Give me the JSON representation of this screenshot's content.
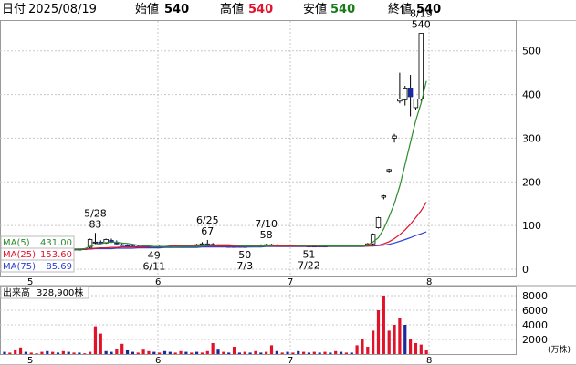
{
  "header": {
    "date_label": "日付",
    "date": "2025/08/19",
    "open_label": "始値",
    "open": "540",
    "high_label": "高値",
    "high": "540",
    "low_label": "安値",
    "low": "540",
    "close_label": "終値",
    "close": "540"
  },
  "ma_legend": [
    {
      "label": "MA(5)",
      "value": "431.00",
      "color": "#2e8b2e"
    },
    {
      "label": "MA(25)",
      "value": "153.60",
      "color": "#e0132b"
    },
    {
      "label": "MA(75)",
      "value": "85.69",
      "color": "#2c3fd1"
    }
  ],
  "volume_label": "出来高",
  "volume_value": "328,900株",
  "volume_unit": "(万株)",
  "colors": {
    "up": "#e0132b",
    "down": "#1a2a9c",
    "grid": "#c8c8c8",
    "ma5": "#2e8b2e",
    "ma25": "#e0132b",
    "ma75": "#2c3fd1"
  },
  "chart_data": {
    "type": "candlestick",
    "price_axis": {
      "ticks": [
        0,
        100,
        200,
        300,
        400,
        500
      ],
      "range": [
        0,
        560
      ]
    },
    "volume_axis": {
      "ticks": [
        2000,
        4000,
        6000,
        8000
      ],
      "range": [
        0,
        9000
      ]
    },
    "month_labels": [
      {
        "label": "5",
        "index": 0
      },
      {
        "label": "6",
        "index": 22
      },
      {
        "label": "7",
        "index": 43
      },
      {
        "label": "8",
        "index": 65
      }
    ],
    "annotations": [
      {
        "index": 17,
        "date": "5/28",
        "value": "83",
        "position": "above"
      },
      {
        "index": 28,
        "date": "6/11",
        "value": "49",
        "position": "below"
      },
      {
        "index": 38,
        "date": "6/25",
        "value": "67",
        "position": "above"
      },
      {
        "index": 45,
        "date": "7/3",
        "value": "50",
        "position": "below"
      },
      {
        "index": 49,
        "date": "7/10",
        "value": "58",
        "position": "above"
      },
      {
        "index": 57,
        "date": "7/22",
        "value": "51",
        "position": "below"
      },
      {
        "index": 78,
        "date": "8/19",
        "value": "540",
        "position": "above"
      }
    ],
    "candles": [
      [
        46,
        47,
        45,
        46
      ],
      [
        46,
        47,
        45,
        46
      ],
      [
        46,
        47,
        45,
        46
      ],
      [
        46,
        47,
        45,
        46
      ],
      [
        46,
        47,
        45,
        46
      ],
      [
        46,
        47,
        45,
        46
      ],
      [
        46,
        47,
        45,
        46
      ],
      [
        46,
        47,
        45,
        46
      ],
      [
        46,
        47,
        45,
        46
      ],
      [
        46,
        47,
        45,
        46
      ],
      [
        46,
        47,
        45,
        46
      ],
      [
        46,
        47,
        45,
        46
      ],
      [
        46,
        47,
        45,
        46
      ],
      [
        46,
        47,
        45,
        46
      ],
      [
        46,
        47,
        45,
        46
      ],
      [
        47,
        48,
        46,
        47
      ],
      [
        50,
        70,
        48,
        68
      ],
      [
        60,
        83,
        58,
        62
      ],
      [
        62,
        66,
        58,
        59
      ],
      [
        60,
        70,
        58,
        68
      ],
      [
        66,
        70,
        60,
        62
      ],
      [
        60,
        66,
        56,
        58
      ],
      [
        56,
        60,
        54,
        55
      ],
      [
        55,
        57,
        52,
        53
      ],
      [
        53,
        55,
        51,
        52
      ],
      [
        52,
        54,
        50,
        52
      ],
      [
        52,
        54,
        50,
        51
      ],
      [
        51,
        53,
        49,
        50
      ],
      [
        50,
        53,
        49,
        52
      ],
      [
        52,
        54,
        50,
        51
      ],
      [
        51,
        53,
        50,
        52
      ],
      [
        52,
        54,
        50,
        51
      ],
      [
        51,
        53,
        50,
        52
      ],
      [
        52,
        54,
        50,
        51
      ],
      [
        51,
        54,
        50,
        53
      ],
      [
        53,
        56,
        51,
        52
      ],
      [
        52,
        58,
        51,
        56
      ],
      [
        56,
        62,
        54,
        58
      ],
      [
        58,
        67,
        55,
        57
      ],
      [
        57,
        60,
        54,
        55
      ],
      [
        55,
        57,
        52,
        53
      ],
      [
        53,
        55,
        51,
        52
      ],
      [
        52,
        54,
        50,
        51
      ],
      [
        51,
        53,
        50,
        52
      ],
      [
        52,
        54,
        50,
        51
      ],
      [
        51,
        53,
        50,
        52
      ],
      [
        52,
        55,
        50,
        53
      ],
      [
        53,
        56,
        51,
        54
      ],
      [
        54,
        57,
        52,
        55
      ],
      [
        55,
        58,
        53,
        56
      ],
      [
        56,
        58,
        54,
        55
      ],
      [
        55,
        57,
        53,
        54
      ],
      [
        54,
        56,
        52,
        53
      ],
      [
        53,
        55,
        52,
        54
      ],
      [
        54,
        56,
        52,
        53
      ],
      [
        53,
        55,
        52,
        54
      ],
      [
        54,
        56,
        52,
        53
      ],
      [
        53,
        55,
        51,
        52
      ],
      [
        52,
        54,
        51,
        53
      ],
      [
        53,
        55,
        51,
        52
      ],
      [
        52,
        54,
        51,
        53
      ],
      [
        53,
        55,
        52,
        54
      ],
      [
        54,
        56,
        52,
        53
      ],
      [
        53,
        55,
        52,
        54
      ],
      [
        54,
        56,
        52,
        53
      ],
      [
        53,
        55,
        52,
        54
      ],
      [
        54,
        56,
        52,
        53
      ],
      [
        53,
        55,
        52,
        54
      ],
      [
        54,
        60,
        52,
        58
      ],
      [
        58,
        82,
        56,
        80
      ],
      [
        95,
        120,
        93,
        118
      ],
      [
        165,
        170,
        160,
        168
      ],
      [
        225,
        230,
        220,
        228
      ],
      [
        300,
        310,
        290,
        305
      ],
      [
        385,
        450,
        380,
        390
      ],
      [
        388,
        420,
        375,
        415
      ],
      [
        415,
        445,
        350,
        395
      ],
      [
        370,
        390,
        365,
        390
      ],
      [
        390,
        540,
        385,
        540
      ]
    ],
    "volume": [
      [
        300,
        "down"
      ],
      [
        200,
        "up"
      ],
      [
        500,
        "up"
      ],
      [
        900,
        "up"
      ],
      [
        300,
        "down"
      ],
      [
        200,
        "up"
      ],
      [
        100,
        "up"
      ],
      [
        300,
        "up"
      ],
      [
        400,
        "down"
      ],
      [
        300,
        "up"
      ],
      [
        200,
        "down"
      ],
      [
        400,
        "up"
      ],
      [
        300,
        "down"
      ],
      [
        200,
        "up"
      ],
      [
        200,
        "down"
      ],
      [
        100,
        "up"
      ],
      [
        300,
        "up"
      ],
      [
        3800,
        "up"
      ],
      [
        2800,
        "up"
      ],
      [
        400,
        "down"
      ],
      [
        300,
        "down"
      ],
      [
        700,
        "up"
      ],
      [
        1400,
        "up"
      ],
      [
        500,
        "down"
      ],
      [
        300,
        "down"
      ],
      [
        200,
        "up"
      ],
      [
        600,
        "up"
      ],
      [
        400,
        "up"
      ],
      [
        300,
        "down"
      ],
      [
        200,
        "up"
      ],
      [
        400,
        "down"
      ],
      [
        300,
        "down"
      ],
      [
        200,
        "up"
      ],
      [
        400,
        "up"
      ],
      [
        300,
        "down"
      ],
      [
        200,
        "up"
      ],
      [
        300,
        "down"
      ],
      [
        200,
        "up"
      ],
      [
        400,
        "up"
      ],
      [
        1500,
        "up"
      ],
      [
        600,
        "down"
      ],
      [
        300,
        "up"
      ],
      [
        200,
        "down"
      ],
      [
        1000,
        "up"
      ],
      [
        200,
        "down"
      ],
      [
        300,
        "up"
      ],
      [
        200,
        "down"
      ],
      [
        400,
        "up"
      ],
      [
        200,
        "down"
      ],
      [
        300,
        "up"
      ],
      [
        1200,
        "up"
      ],
      [
        400,
        "down"
      ],
      [
        200,
        "up"
      ],
      [
        300,
        "down"
      ],
      [
        200,
        "up"
      ],
      [
        400,
        "down"
      ],
      [
        300,
        "up"
      ],
      [
        200,
        "down"
      ],
      [
        300,
        "up"
      ],
      [
        200,
        "down"
      ],
      [
        300,
        "up"
      ],
      [
        200,
        "down"
      ],
      [
        400,
        "up"
      ],
      [
        300,
        "down"
      ],
      [
        200,
        "up"
      ],
      [
        200,
        "down"
      ],
      [
        1200,
        "up"
      ],
      [
        2000,
        "up"
      ],
      [
        1000,
        "up"
      ],
      [
        3200,
        "up"
      ],
      [
        6000,
        "up"
      ],
      [
        8000,
        "up"
      ],
      [
        3200,
        "up"
      ],
      [
        4000,
        "up"
      ],
      [
        5000,
        "up"
      ],
      [
        4000,
        "down"
      ],
      [
        2000,
        "up"
      ],
      [
        1500,
        "up"
      ],
      [
        1300,
        "up"
      ],
      [
        500,
        "up"
      ]
    ],
    "ma5": [
      46,
      46,
      46,
      46,
      46,
      46,
      46,
      46,
      46,
      46,
      46,
      46,
      46,
      46,
      46,
      47,
      52,
      56,
      58,
      61,
      62,
      62,
      60,
      59,
      57,
      55,
      54,
      53,
      52,
      52,
      52,
      52,
      51,
      52,
      52,
      52,
      52,
      53,
      54,
      55,
      56,
      56,
      56,
      55,
      54,
      53,
      53,
      52,
      53,
      53,
      54,
      55,
      55,
      55,
      55,
      54,
      54,
      54,
      54,
      54,
      53,
      53,
      53,
      53,
      53,
      53,
      53,
      53,
      55,
      62,
      72,
      92,
      120,
      150,
      190,
      240,
      290,
      340,
      380,
      431
    ],
    "ma25": [
      46,
      46,
      46,
      46,
      46,
      46,
      46,
      46,
      46,
      46,
      46,
      46,
      46,
      46,
      46,
      46,
      47,
      48,
      49,
      49,
      50,
      50,
      51,
      51,
      51,
      51,
      51,
      52,
      52,
      52,
      52,
      53,
      53,
      53,
      53,
      53,
      53,
      53,
      53,
      53,
      53,
      53,
      53,
      53,
      53,
      53,
      53,
      53,
      53,
      53,
      53,
      53,
      53,
      53,
      53,
      53,
      53,
      53,
      53,
      53,
      53,
      53,
      53,
      53,
      53,
      53,
      53,
      53,
      53,
      54,
      55,
      58,
      63,
      70,
      79,
      90,
      103,
      118,
      134,
      153.6
    ],
    "ma75": [
      46,
      46,
      46,
      46,
      46,
      46,
      46,
      46,
      46,
      46,
      46,
      46,
      46,
      46,
      46,
      46,
      46,
      47,
      47,
      47,
      47,
      48,
      48,
      48,
      48,
      49,
      49,
      49,
      49,
      49,
      50,
      50,
      50,
      50,
      50,
      50,
      50,
      51,
      51,
      51,
      51,
      51,
      51,
      51,
      51,
      51,
      51,
      51,
      51,
      52,
      52,
      52,
      52,
      52,
      52,
      52,
      52,
      52,
      52,
      52,
      52,
      52,
      52,
      52,
      52,
      52,
      52,
      52,
      53,
      53,
      54,
      55,
      57,
      60,
      64,
      68,
      72,
      77,
      81,
      85.69
    ]
  }
}
